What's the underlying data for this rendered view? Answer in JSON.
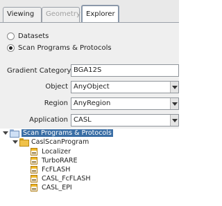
{
  "tabs": [
    {
      "label": "Viewing"
    },
    {
      "label": "Geometry"
    },
    {
      "label": "Explorer"
    }
  ],
  "radio_options": [
    {
      "label": "Datasets",
      "selected": false
    },
    {
      "label": "Scan Programs & Protocols",
      "selected": true
    }
  ],
  "form": {
    "gradient_category_label": "Gradient Category",
    "gradient_category_value": "BGA12S",
    "object_label": "Object",
    "object_value": "AnyObject",
    "region_label": "Region",
    "region_value": "AnyRegion",
    "application_label": "Application",
    "application_value": "CASL"
  },
  "tree": {
    "root": {
      "label": "Scan Programs & Protocols"
    },
    "program": {
      "label": "CaslScanProgram"
    },
    "protocols": [
      {
        "label": "Localizer"
      },
      {
        "label": "TurboRARE"
      },
      {
        "label": "FcFLASH"
      },
      {
        "label": "CASL_FcFLASH"
      },
      {
        "label": "CASL_EPI"
      }
    ]
  }
}
